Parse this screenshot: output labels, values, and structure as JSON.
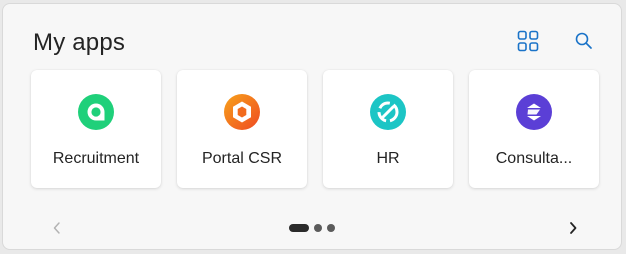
{
  "header": {
    "title": "My apps",
    "grid_icon": "app-grid-icon",
    "search_icon": "search-icon",
    "accent_color": "#1a73c8"
  },
  "apps": [
    {
      "name": "Recruitment",
      "icon": "recruitment-app-icon",
      "color": "#1fd07a"
    },
    {
      "name": "Portal CSR",
      "icon": "portal-csr-app-icon",
      "color": "#f26b1d"
    },
    {
      "name": "HR",
      "icon": "hr-app-icon",
      "color": "#1cc5c5"
    },
    {
      "name": "Consulta...",
      "icon": "consulta-app-icon",
      "color": "#5b3fd6"
    }
  ],
  "pager": {
    "pages": 3,
    "current": 1,
    "prev_icon": "chevron-left-icon",
    "next_icon": "chevron-right-icon"
  }
}
